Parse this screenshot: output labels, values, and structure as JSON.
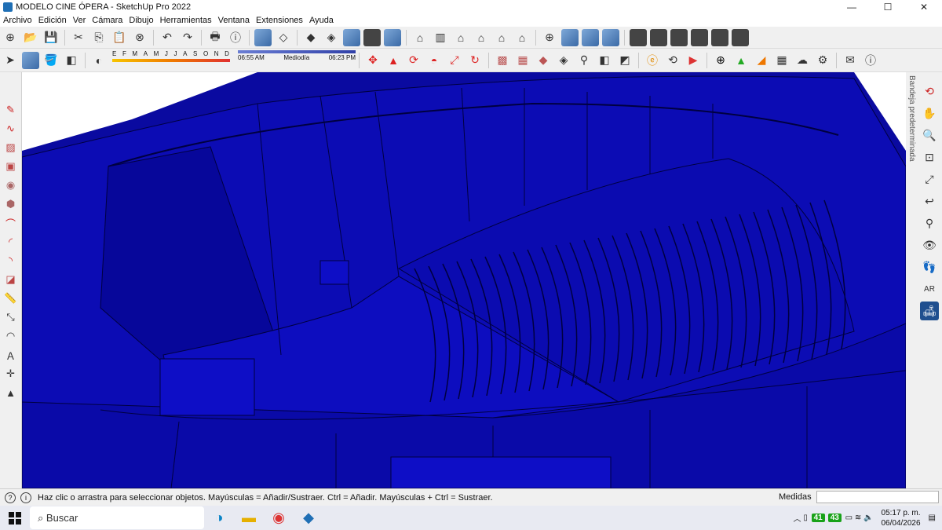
{
  "window": {
    "title": "MODELO CINE ÓPERA - SketchUp Pro 2022"
  },
  "menu": [
    "Archivo",
    "Edición",
    "Ver",
    "Cámara",
    "Dibujo",
    "Herramientas",
    "Ventana",
    "Extensiones",
    "Ayuda"
  ],
  "shadow": {
    "months": [
      "E",
      "F",
      "M",
      "A",
      "M",
      "J",
      "J",
      "A",
      "S",
      "O",
      "N",
      "D"
    ],
    "time_start": "06:55 AM",
    "time_mid": "Mediodía",
    "time_end": "06:23 PM"
  },
  "tray": {
    "label": "Bandeja predeterminada"
  },
  "status": {
    "message": "Haz clic o arrastra para seleccionar objetos. Mayúsculas = Añadir/Sustraer. Ctrl = Añadir. Mayúsculas + Ctrl = Sustraer.",
    "measures_label": "Medidas"
  },
  "taskbar": {
    "search_placeholder": "Buscar",
    "badge1": "41",
    "badge2": "43",
    "time": "05:17 p. m.",
    "date": "06/04/2026"
  },
  "colors": {
    "model": "#0a0aa0",
    "edges": "#000040"
  }
}
